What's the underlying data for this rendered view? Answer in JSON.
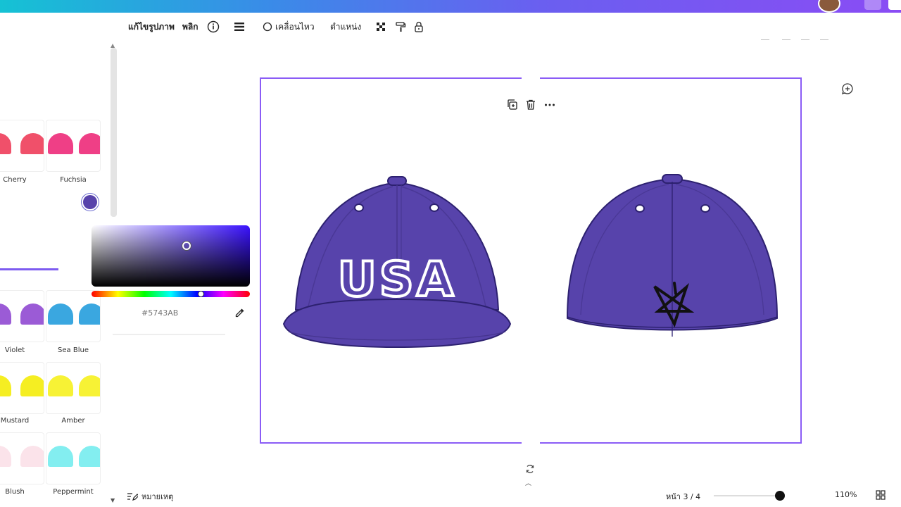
{
  "topbar": {
    "title": ""
  },
  "toolbar": {
    "edit_image": "แก้ไขรูปภาพ",
    "flip": "พลิก",
    "animate": "เคลื่อนไหว",
    "position": "ตำแหน่ง"
  },
  "color_panel": {
    "top_row": [
      "Cherry",
      "Fuchsia"
    ],
    "rows": [
      {
        "labels": [
          "Violet",
          "Sea Blue"
        ],
        "colors": [
          "#9b5bd6",
          "#3aa7e0"
        ]
      },
      {
        "labels": [
          "Mustard",
          "Amber"
        ],
        "colors": [
          "#f5ee22",
          "#f7f235"
        ]
      },
      {
        "labels": [
          "Blush",
          "Peppermint"
        ],
        "colors": [
          "#fbe3ea",
          "#83eef0"
        ]
      }
    ],
    "top_colors": [
      "#f0506a",
      "#ef3f86"
    ],
    "hex_value": "#5743AB",
    "selected_color": "#5743AB"
  },
  "canvas": {
    "cap_color": "#5743AB",
    "front_text": "USA"
  },
  "bottom": {
    "notes": "หมายเหตุ",
    "page": "หน้า 3 / 4",
    "zoom": "110%"
  }
}
